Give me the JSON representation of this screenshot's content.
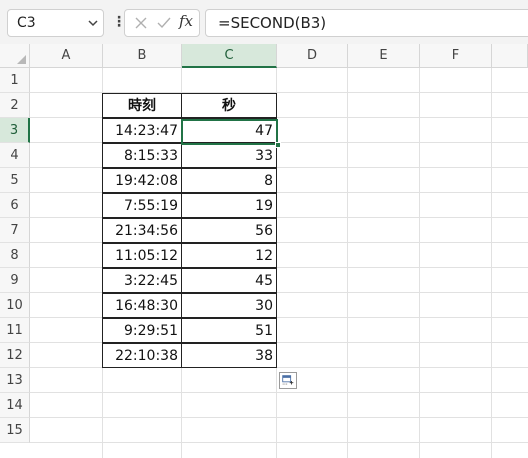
{
  "name_box": {
    "value": "C3"
  },
  "formula_bar": {
    "formula": "=SECOND(B3)"
  },
  "columns": [
    "A",
    "B",
    "C",
    "D",
    "E",
    "F"
  ],
  "selected_column": "C",
  "rows": [
    "1",
    "2",
    "3",
    "4",
    "5",
    "6",
    "7",
    "8",
    "9",
    "10",
    "11",
    "12",
    "13",
    "14",
    "15"
  ],
  "selected_row": "3",
  "table": {
    "header_time": "時刻",
    "header_seconds": "秒",
    "times": [
      "14:23:47",
      "8:15:33",
      "19:42:08",
      "7:55:19",
      "21:34:56",
      "11:05:12",
      "3:22:45",
      "16:48:30",
      "9:29:51",
      "22:10:38"
    ],
    "seconds": [
      "47",
      "33",
      "8",
      "19",
      "56",
      "12",
      "45",
      "30",
      "51",
      "38"
    ]
  },
  "icons": {
    "namebox_dropdown": "chevron-down-icon",
    "cancel": "cancel-x-icon",
    "enter": "checkmark-icon",
    "insert_function": "fx-icon",
    "quick_analysis": "quick-analysis-icon"
  },
  "colors": {
    "accent": "#217346",
    "header_selected_bg": "#d7e8db",
    "header_bg": "#f7f7f7",
    "gridline": "#e1e1e1"
  }
}
